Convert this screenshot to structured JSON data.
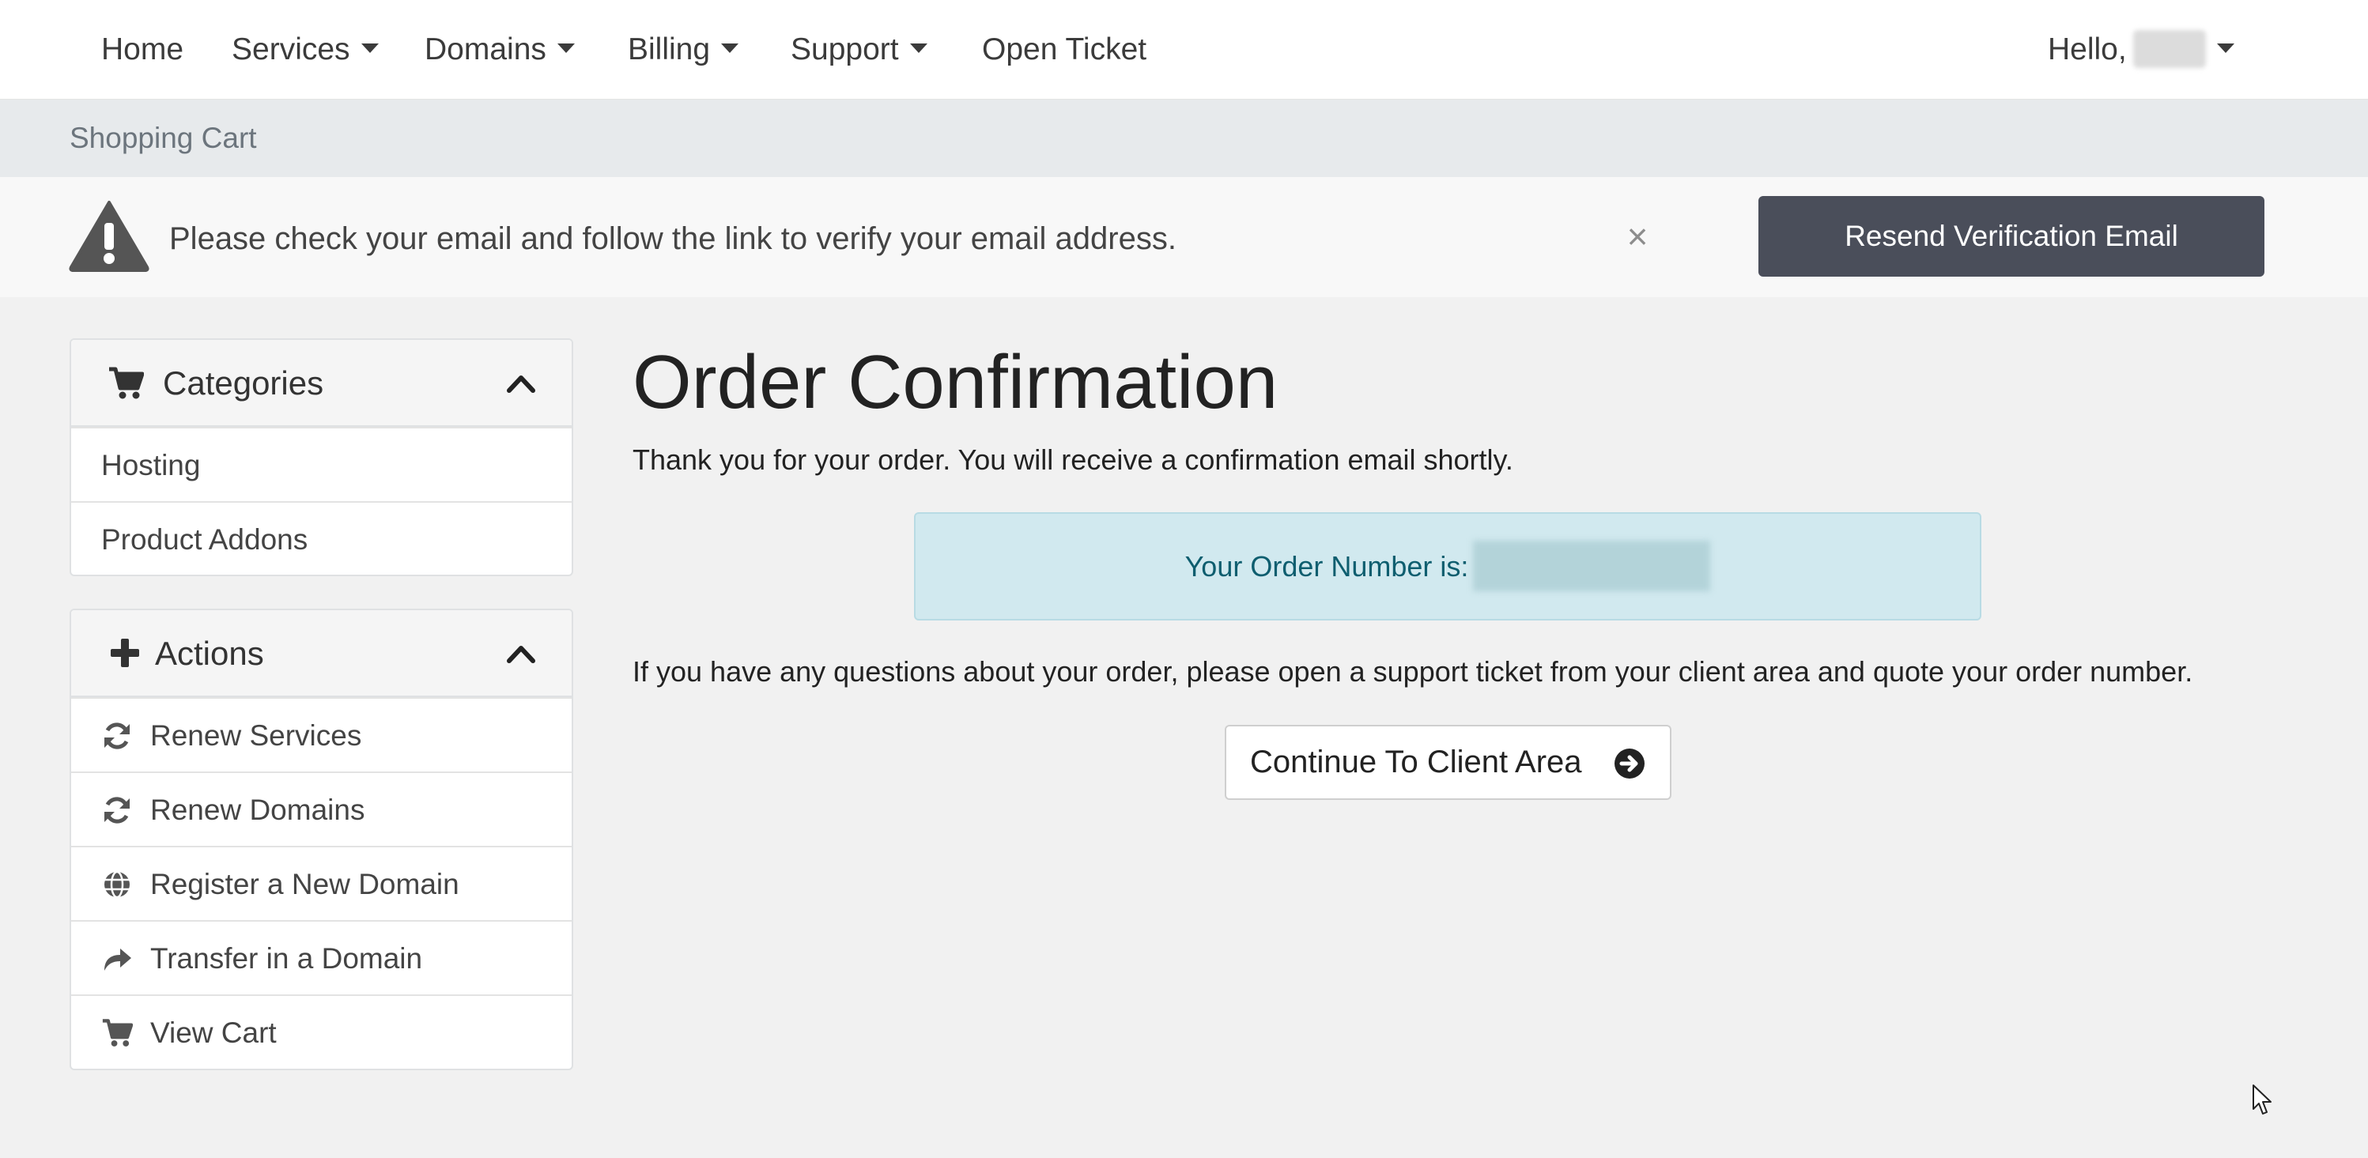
{
  "nav": {
    "home": "Home",
    "services": "Services",
    "domains": "Domains",
    "billing": "Billing",
    "support": "Support",
    "open_ticket": "Open Ticket",
    "hello": "Hello,"
  },
  "breadcrumb": {
    "current": "Shopping Cart"
  },
  "alert": {
    "message": "Please check your email and follow the link to verify your email address.",
    "close": "×",
    "resend_label": "Resend Verification Email"
  },
  "sidebar": {
    "categories": {
      "title": "Categories",
      "items": [
        {
          "label": "Hosting"
        },
        {
          "label": "Product Addons"
        }
      ]
    },
    "actions": {
      "title": "Actions",
      "items": [
        {
          "label": "Renew Services",
          "icon": "refresh-icon"
        },
        {
          "label": "Renew Domains",
          "icon": "refresh-icon"
        },
        {
          "label": "Register a New Domain",
          "icon": "globe-icon"
        },
        {
          "label": "Transfer in a Domain",
          "icon": "share-arrow-icon"
        },
        {
          "label": "View Cart",
          "icon": "cart-icon"
        }
      ]
    }
  },
  "main": {
    "title": "Order Confirmation",
    "thanks": "Thank you for your order. You will receive a confirmation email shortly.",
    "order_label": "Your Order Number is:",
    "help": "If you have any questions about your order, please open a support ticket from your client area and quote your order number.",
    "continue_label": "Continue To Client Area"
  },
  "colors": {
    "resend_button": "#4a4e5a",
    "order_box_bg": "#d1e9ef",
    "order_box_text": "#0e5e6f",
    "page_bg": "#f1f1f1"
  }
}
